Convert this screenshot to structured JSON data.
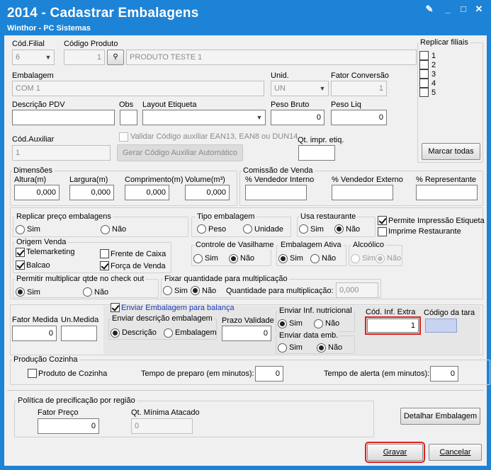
{
  "window": {
    "title": "2014 - Cadastrar Embalagens",
    "subtitle": "Winthor - PC Sistemas"
  },
  "top": {
    "cod_filial_label": "Cód.Filial",
    "cod_filial_value": "6",
    "codigo_produto_label": "Código Produto",
    "codigo_produto_value": "1",
    "produto_nome": "PRODUTO TESTE 1",
    "embalagem_label": "Embalagem",
    "embalagem_value": "COM 1",
    "unid_label": "Unid.",
    "unid_value": "UN",
    "fator_conversao_label": "Fator Conversão",
    "fator_conversao_value": "1",
    "descricao_pdv_label": "Descrição PDV",
    "descricao_pdv_value": "",
    "obs_label": "Obs",
    "layout_etiqueta_label": "Layout Etiqueta",
    "peso_bruto_label": "Peso Bruto",
    "peso_bruto_value": "0",
    "peso_liq_label": "Peso Liq",
    "peso_liq_value": "0",
    "cod_auxiliar_label": "Cód.Auxiliar",
    "cod_auxiliar_value": "1",
    "validar_label": "Validar Código auxiliar EAN13, EAN8 ou DUN14",
    "gerar_label": "Gerar Código Auxiliar Automático",
    "qt_impr_label": "Qt. impr. etiq.",
    "qt_impr_value": ""
  },
  "replicar_filiais": {
    "title": "Replicar filiais",
    "items": [
      "1",
      "2",
      "3",
      "4",
      "5"
    ],
    "marcar_todas": "Marcar todas"
  },
  "dimensoes": {
    "title": "Dimensões",
    "altura_label": "Altura(m)",
    "altura": "0,000",
    "largura_label": "Largura(m)",
    "largura": "0,000",
    "comprimento_label": "Comprimento(m)",
    "comprimento": "0,000",
    "volume_label": "Volume(m³)",
    "volume": "0,000"
  },
  "comissao": {
    "title": "Comissão de Venda",
    "interno": "% Vendedor Interno",
    "externo": "% Vendedor Externo",
    "representante": "% Representante"
  },
  "replicar_preco": {
    "title": "Replicar preço embalagens",
    "sim": "Sim",
    "nao": "Não"
  },
  "tipo_embalagem": {
    "title": "Tipo embalagem",
    "peso": "Peso",
    "unidade": "Unidade"
  },
  "usa_restaurante": {
    "title": "Usa restaurante",
    "sim": "Sim",
    "nao": "Não"
  },
  "permite_impressao": "Permite Impressão Etiqueta",
  "imprime_restaurante": "Imprime Restaurante",
  "origem_venda": {
    "title": "Origem Venda",
    "telemarketing": "Telemarketing",
    "balcao": "Balcao",
    "frente_caixa": "Frente de Caixa",
    "forca_venda": "Força de Venda"
  },
  "controle_vasilhame": {
    "title": "Controle de Vasilhame",
    "sim": "Sim",
    "nao": "Não"
  },
  "embalagem_ativa": {
    "title": "Embalagem Ativa",
    "sim": "Sim",
    "nao": "Não"
  },
  "alcoolico": {
    "title": "Alcoólico",
    "sim": "Sim",
    "nao": "Não"
  },
  "permitir_multiplicar": {
    "title": "Permitir multiplicar qtde no check out",
    "sim": "Sim",
    "nao": "Não"
  },
  "fixar_quantidade": {
    "title": "Fixar quantidade para multiplicação",
    "sim": "Sim",
    "nao": "Não",
    "qtd_label": "Quantidade para multiplicação:",
    "qtd_value": "0,000"
  },
  "balanca": {
    "fator_medida_label": "Fator Medida",
    "fator_medida": "0",
    "un_medida_label": "Un.Medida",
    "enviar_balanca": "Enviar Embalagem para balança",
    "enviar_desc_title": "Enviar descrição embalagem",
    "descricao": "Descrição",
    "embalagem": "Embalagem",
    "prazo_validade_label": "Prazo Validade",
    "prazo_validade": "0",
    "enviar_nutricional": "Enviar Inf. nutricional",
    "sim": "Sim",
    "nao": "Não",
    "enviar_data": "Enviar data emb.",
    "cod_inf_extra_label": "Cód. Inf. Extra",
    "cod_inf_extra": "1",
    "codigo_tara_label": "Código da tara"
  },
  "producao": {
    "title": "Produção Cozinha",
    "produto_cozinha": "Produto de Cozinha",
    "tempo_preparo_label": "Tempo de preparo (em minutos):",
    "tempo_preparo": "0",
    "tempo_alerta_label": "Tempo de alerta (em minutos):",
    "tempo_alerta": "0"
  },
  "politica": {
    "title": "Política de precificação por região",
    "fator_preco_label": "Fator Preço",
    "fator_preco": "0",
    "qt_minima_label": "Qt. Mínima Atacado",
    "qt_minima": "0"
  },
  "buttons": {
    "detalhar": "Detalhar Embalagem",
    "gravar": "Gravar",
    "cancelar": "Cancelar"
  }
}
